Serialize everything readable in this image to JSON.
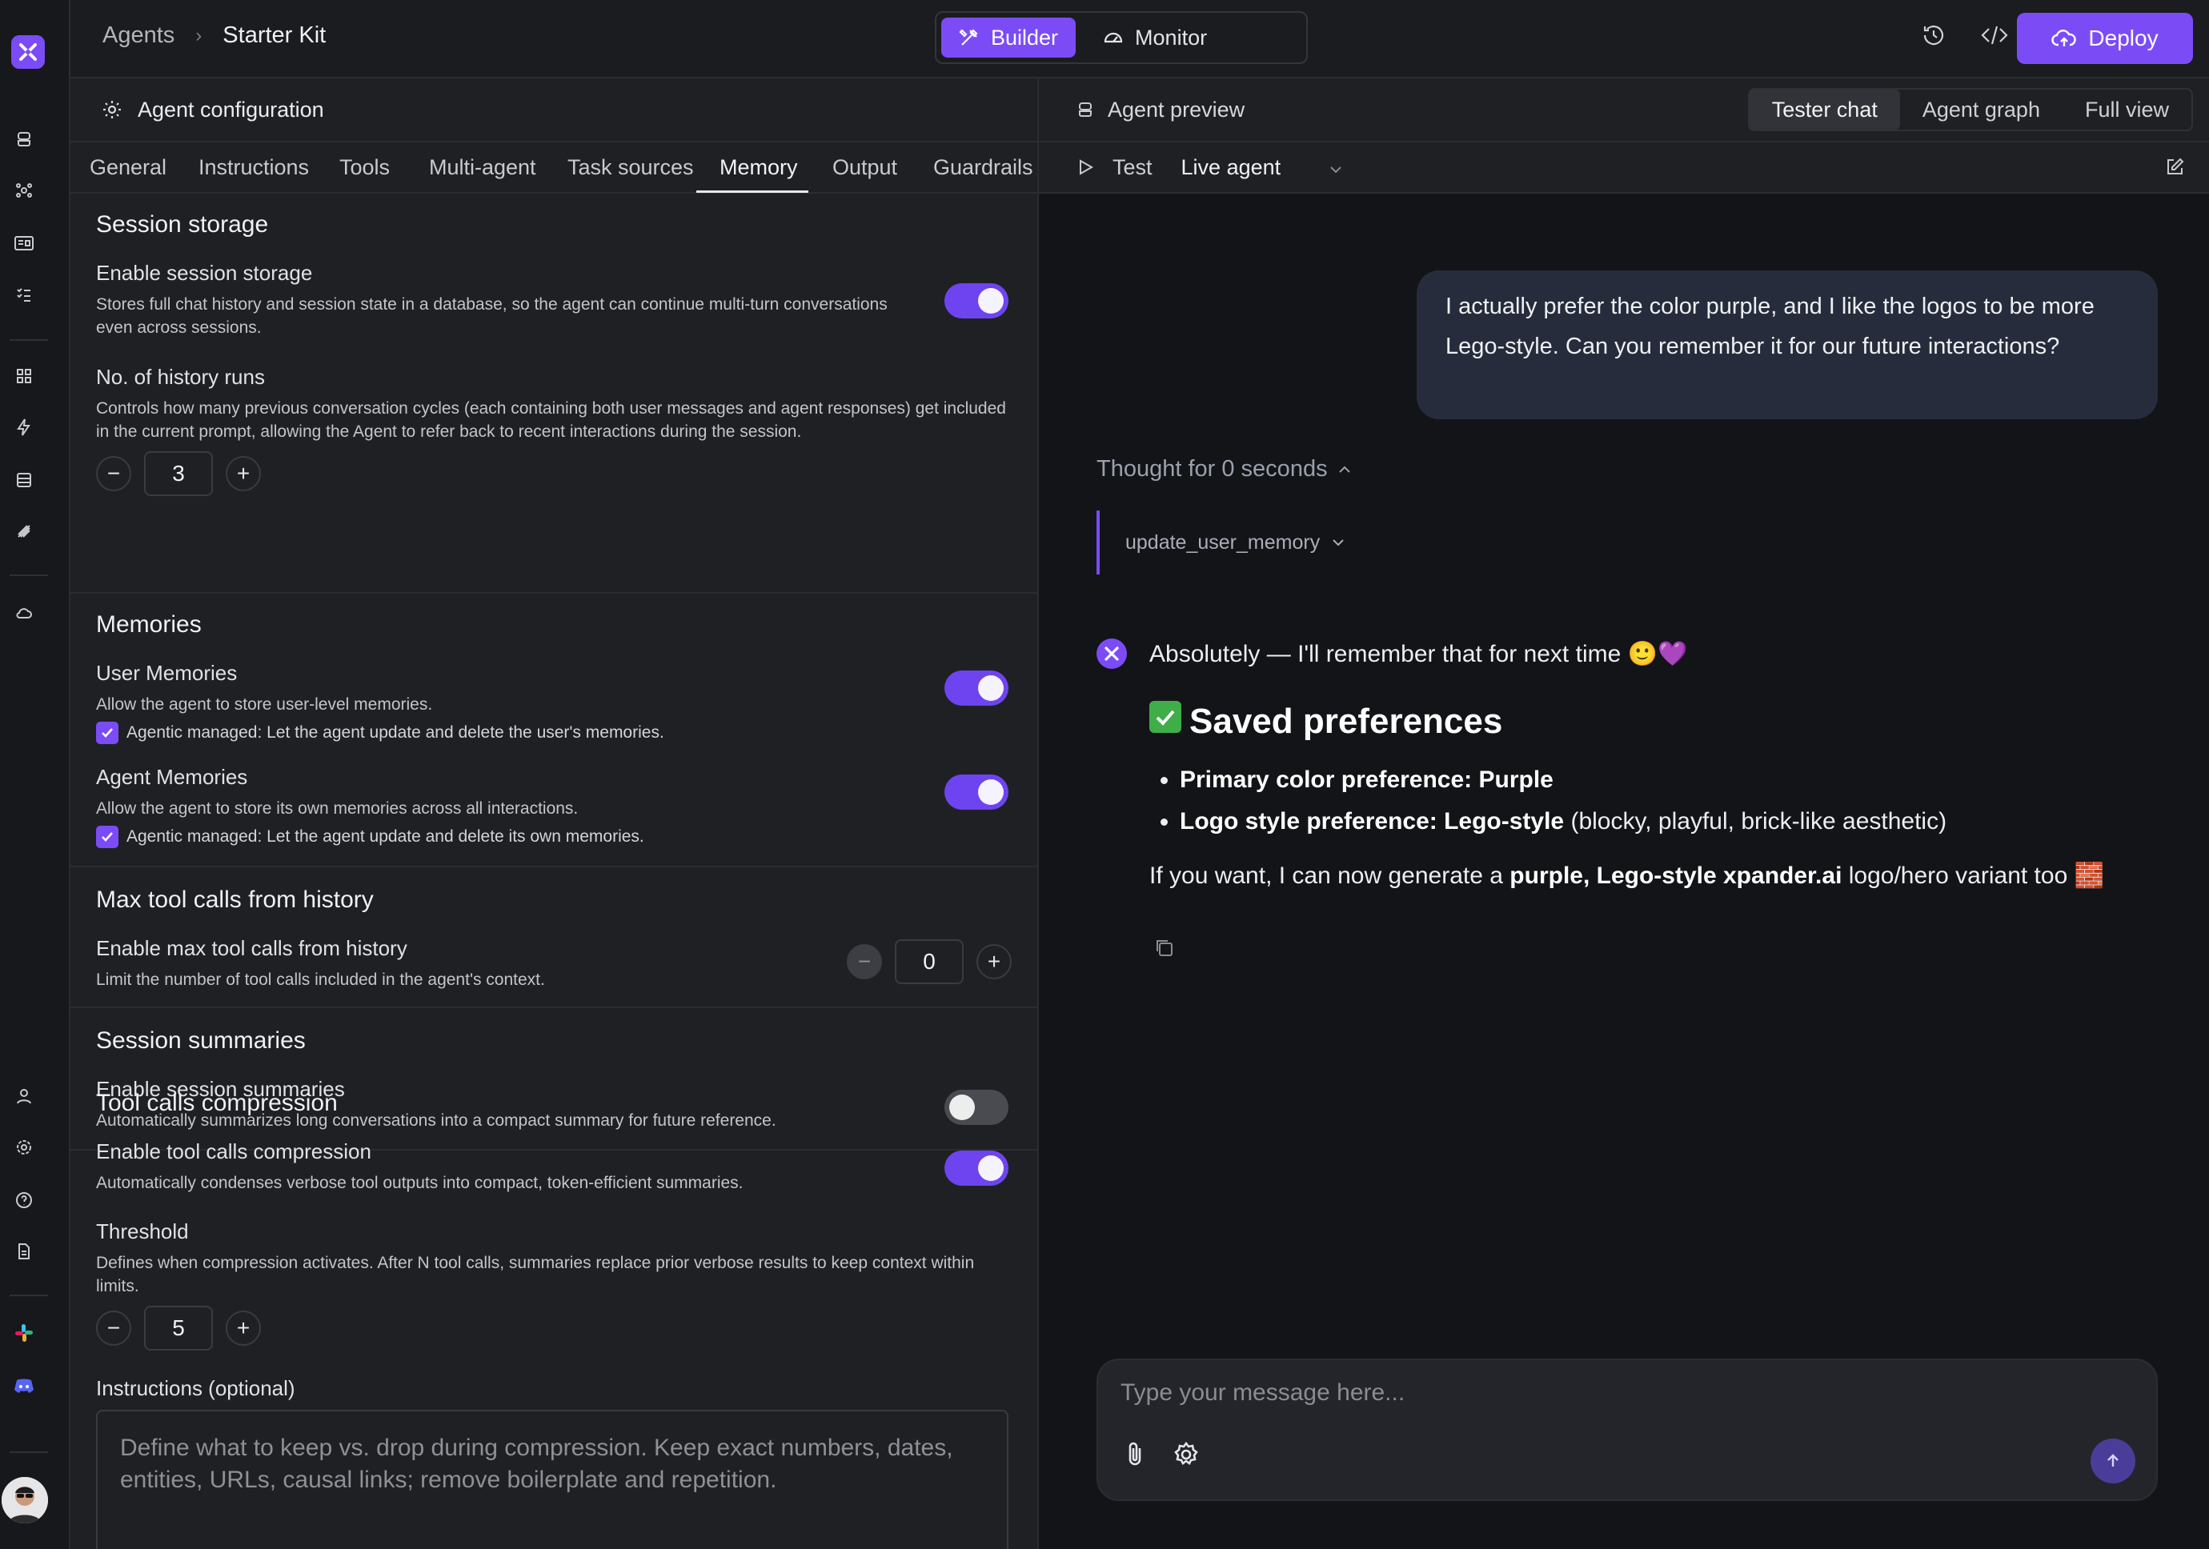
{
  "breadcrumb": {
    "root": "Agents",
    "current": "Starter Kit"
  },
  "mode_switch": {
    "builder": "Builder",
    "monitor": "Monitor"
  },
  "deploy_label": "Deploy",
  "config": {
    "title": "Agent configuration",
    "tabs": [
      "General",
      "Instructions",
      "Tools",
      "Multi-agent",
      "Task sources",
      "Memory",
      "Output",
      "Guardrails"
    ],
    "active_tab": "Memory",
    "session_storage": {
      "heading": "Session storage",
      "label": "Enable session storage",
      "desc": "Stores full chat history and session state in a database, so the agent can continue multi-turn conversations even across sessions.",
      "enabled": true,
      "history_label": "No. of history runs",
      "history_desc": "Controls how many previous conversation cycles (each containing both user messages and agent responses) get included in the current prompt, allowing the Agent to refer back to recent interactions during the session.",
      "history_runs": "3"
    },
    "memories": {
      "heading": "Memories",
      "user_label": "User Memories",
      "user_desc": "Allow the agent to store user-level memories.",
      "user_enabled": true,
      "user_check": "Agentic managed: Let the agent update and delete the user's memories.",
      "agent_label": "Agent Memories",
      "agent_desc": "Allow the agent to store its own memories across all interactions.",
      "agent_enabled": true,
      "agent_check": "Agentic managed: Let the agent update and delete its own memories."
    },
    "max_tool_calls": {
      "heading": "Max tool calls from history",
      "label": "Enable max tool calls from history",
      "desc": "Limit the number of tool calls included in the agent's context.",
      "value": "0"
    },
    "session_summaries": {
      "heading": "Session summaries",
      "label": "Enable session summaries",
      "desc": "Automatically summarizes long conversations into a compact summary for future reference.",
      "enabled": false
    },
    "compression": {
      "heading": "Tool calls compression",
      "label": "Enable tool calls compression",
      "desc": "Automatically condenses verbose tool outputs into compact, token-efficient summaries.",
      "enabled": true,
      "threshold_label": "Threshold",
      "threshold_desc": "Defines when compression activates. After N tool calls, summaries replace prior verbose results to keep context within limits.",
      "threshold": "5",
      "instructions_label": "Instructions (optional)",
      "instructions_placeholder": "Define what to keep vs. drop during compression. Keep exact numbers, dates, entities, URLs, causal links; remove boilerplate and repetition."
    }
  },
  "preview": {
    "title": "Agent preview",
    "view_tabs": [
      "Tester chat",
      "Agent graph",
      "Full view"
    ],
    "active_view": "Tester chat",
    "test_label": "Test",
    "agent_select": "Live agent",
    "user_message": "I actually prefer the color purple, and I like the logos to be more Lego-style. Can you remember it for our future interactions?",
    "thought": "Thought for 0 seconds",
    "tool_call": "update_user_memory",
    "response": {
      "intro": "Absolutely — I'll remember that for next time 🙂💜",
      "heading": "Saved preferences",
      "item1_bold": "Primary color preference: Purple",
      "item2_bold": "Logo style preference: Lego-style",
      "item2_rest": "(blocky, playful, brick-like aesthetic)",
      "outro_pre": "If you want, I can now generate a",
      "outro_bold": "purple, Lego-style xpander.ai",
      "outro_post": "logo/hero variant too 🧱"
    },
    "composer_placeholder": "Type your message here..."
  },
  "colors": {
    "accent": "#7b4cf6",
    "bg": "#1f2024",
    "chat_bg": "#131417",
    "bubble": "#262c3b"
  }
}
